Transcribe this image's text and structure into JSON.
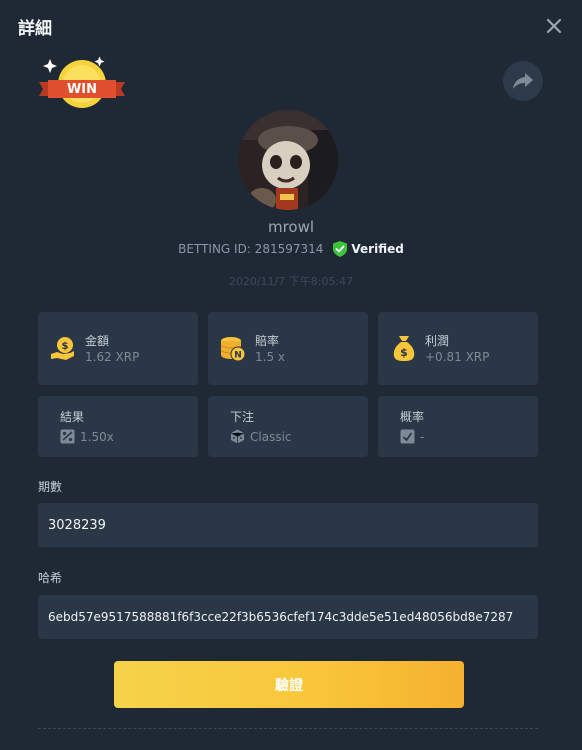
{
  "header": {
    "title": "詳細"
  },
  "badge": {
    "text": "WIN"
  },
  "user": {
    "name": "mrowl"
  },
  "bet": {
    "id_label": "BETTING ID: 281597314",
    "verified": "Verified",
    "timestamp": "2020/11/7 下午8:05:47"
  },
  "stats": [
    {
      "label": "金額",
      "value": "1.62 XRP",
      "icon": "money-hand-icon"
    },
    {
      "label": "賠率",
      "value": "1.5 x",
      "icon": "coins-icon"
    },
    {
      "label": "利潤",
      "value": "+0.81 XRP",
      "icon": "money-bag-icon"
    }
  ],
  "details": [
    {
      "label": "結果",
      "value": "1.50x",
      "icon": "result-icon"
    },
    {
      "label": "下注",
      "value": "Classic",
      "icon": "dice-icon"
    },
    {
      "label": "概率",
      "value": "-",
      "icon": "probability-icon"
    }
  ],
  "period": {
    "label": "期數",
    "value": "3028239"
  },
  "hash": {
    "label": "哈希",
    "value": "6ebd57e9517588881f6f3cce22f3b6536cfef174c3dde5e51ed48056bd8e7287"
  },
  "actions": {
    "verify_label": "驗證"
  },
  "colors": {
    "background": "#1f2935",
    "card": "#2a3746",
    "accent": "#f9c53a",
    "verified": "#3ec23e"
  }
}
